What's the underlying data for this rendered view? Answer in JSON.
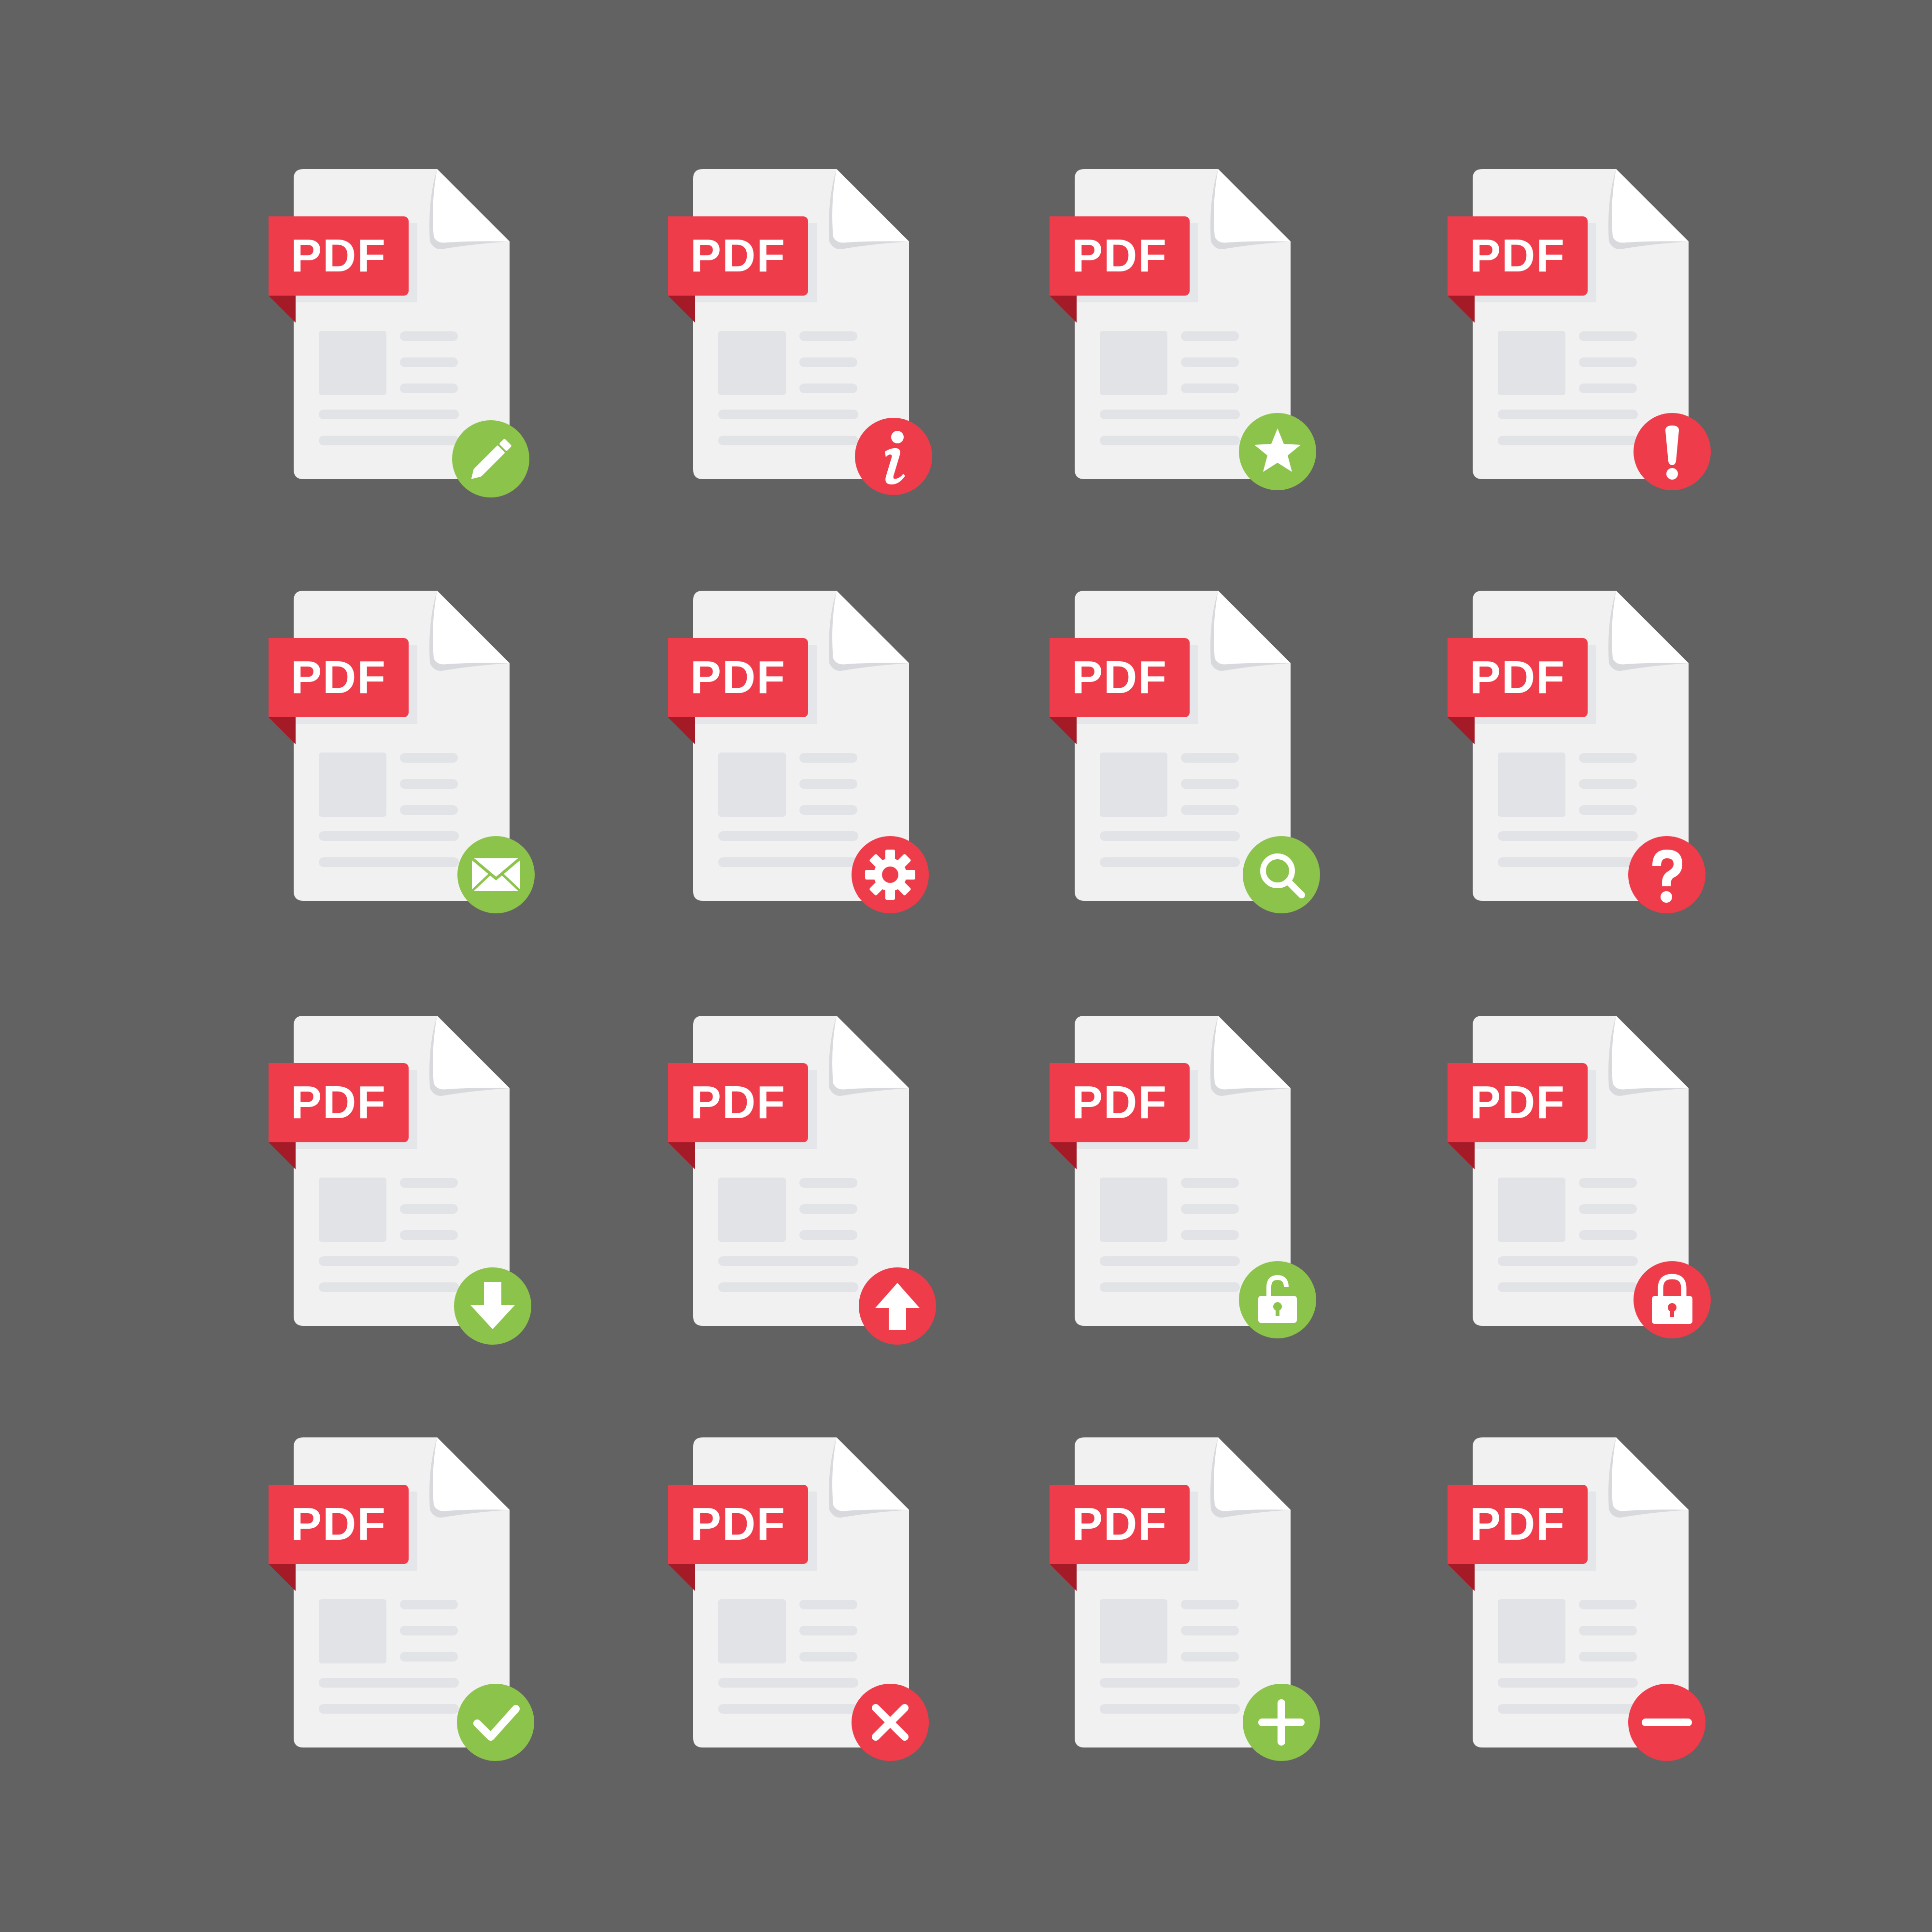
{
  "colors": {
    "background": "#626262",
    "page": "#f1f1f1",
    "placeholder": "#e1e3e6",
    "label": "#ef3c4b",
    "label_fold": "#a51a27",
    "green": "#8cc34b",
    "red": "#ef3c4b"
  },
  "icons": [
    {
      "label": "PDF",
      "badge": "pencil-icon",
      "badge_color": "green"
    },
    {
      "label": "PDF",
      "badge": "info-icon",
      "badge_color": "red"
    },
    {
      "label": "PDF",
      "badge": "star-icon",
      "badge_color": "green"
    },
    {
      "label": "PDF",
      "badge": "exclamation-icon",
      "badge_color": "red"
    },
    {
      "label": "PDF",
      "badge": "envelope-icon",
      "badge_color": "green"
    },
    {
      "label": "PDF",
      "badge": "gear-icon",
      "badge_color": "red"
    },
    {
      "label": "PDF",
      "badge": "magnifier-icon",
      "badge_color": "green"
    },
    {
      "label": "PDF",
      "badge": "question-icon",
      "badge_color": "red"
    },
    {
      "label": "PDF",
      "badge": "download-arrow-icon",
      "badge_color": "green"
    },
    {
      "label": "PDF",
      "badge": "upload-arrow-icon",
      "badge_color": "red"
    },
    {
      "label": "PDF",
      "badge": "unlocked-padlock-icon",
      "badge_color": "green"
    },
    {
      "label": "PDF",
      "badge": "locked-padlock-icon",
      "badge_color": "red"
    },
    {
      "label": "PDF",
      "badge": "checkmark-icon",
      "badge_color": "green"
    },
    {
      "label": "PDF",
      "badge": "cross-icon",
      "badge_color": "red"
    },
    {
      "label": "PDF",
      "badge": "plus-icon",
      "badge_color": "green"
    },
    {
      "label": "PDF",
      "badge": "minus-icon",
      "badge_color": "red"
    }
  ]
}
